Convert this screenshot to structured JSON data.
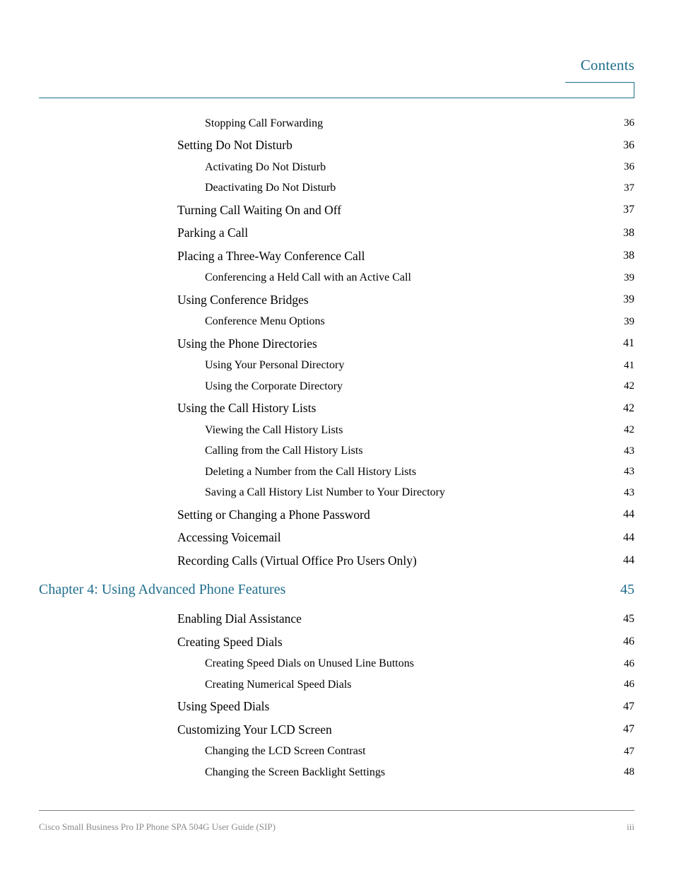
{
  "header": {
    "title": "Contents",
    "accent_color": "#1f6e8c"
  },
  "toc": {
    "entries": [
      {
        "level": 2,
        "label": "Stopping Call Forwarding",
        "page": "36"
      },
      {
        "level": 1,
        "label": "Setting Do Not Disturb",
        "page": "36"
      },
      {
        "level": 2,
        "label": "Activating Do Not Disturb",
        "page": "36"
      },
      {
        "level": 2,
        "label": "Deactivating Do Not Disturb",
        "page": "37"
      },
      {
        "level": 1,
        "label": "Turning Call Waiting On and Off",
        "page": "37"
      },
      {
        "level": 1,
        "label": "Parking a Call",
        "page": "38"
      },
      {
        "level": 1,
        "label": "Placing a Three-Way Conference Call",
        "page": "38"
      },
      {
        "level": 2,
        "label": "Conferencing a Held Call with an Active Call",
        "page": "39"
      },
      {
        "level": 1,
        "label": "Using Conference Bridges",
        "page": "39"
      },
      {
        "level": 2,
        "label": "Conference Menu Options",
        "page": "39"
      },
      {
        "level": 1,
        "label": "Using the Phone Directories",
        "page": "41"
      },
      {
        "level": 2,
        "label": "Using Your Personal Directory",
        "page": "41"
      },
      {
        "level": 2,
        "label": "Using the Corporate Directory",
        "page": "42"
      },
      {
        "level": 1,
        "label": "Using the Call History Lists",
        "page": "42"
      },
      {
        "level": 2,
        "label": "Viewing the Call History Lists",
        "page": "42"
      },
      {
        "level": 2,
        "label": "Calling from the Call History Lists",
        "page": "43"
      },
      {
        "level": 2,
        "label": "Deleting a Number from the Call History Lists",
        "page": "43"
      },
      {
        "level": 2,
        "label": "Saving a Call History List Number to Your Directory",
        "page": "43"
      },
      {
        "level": 1,
        "label": "Setting or Changing a Phone Password",
        "page": "44"
      },
      {
        "level": 1,
        "label": "Accessing Voicemail",
        "page": "44"
      },
      {
        "level": 1,
        "label": "Recording Calls (Virtual Office Pro Users Only)",
        "page": "44"
      },
      {
        "level": 0,
        "label": "Chapter 4: Using Advanced Phone Features",
        "page": "45"
      },
      {
        "level": 1,
        "label": "Enabling Dial Assistance",
        "page": "45"
      },
      {
        "level": 1,
        "label": "Creating Speed Dials",
        "page": "46"
      },
      {
        "level": 2,
        "label": "Creating Speed Dials on Unused Line Buttons",
        "page": "46"
      },
      {
        "level": 2,
        "label": "Creating Numerical Speed Dials",
        "page": "46"
      },
      {
        "level": 1,
        "label": "Using Speed Dials",
        "page": "47"
      },
      {
        "level": 1,
        "label": "Customizing Your LCD Screen",
        "page": "47"
      },
      {
        "level": 2,
        "label": "Changing the LCD Screen Contrast",
        "page": "47"
      },
      {
        "level": 2,
        "label": "Changing the Screen Backlight Settings",
        "page": "48"
      }
    ]
  },
  "footer": {
    "document_title": "Cisco Small Business Pro IP Phone SPA 504G User Guide (SIP)",
    "page_number": "iii"
  }
}
